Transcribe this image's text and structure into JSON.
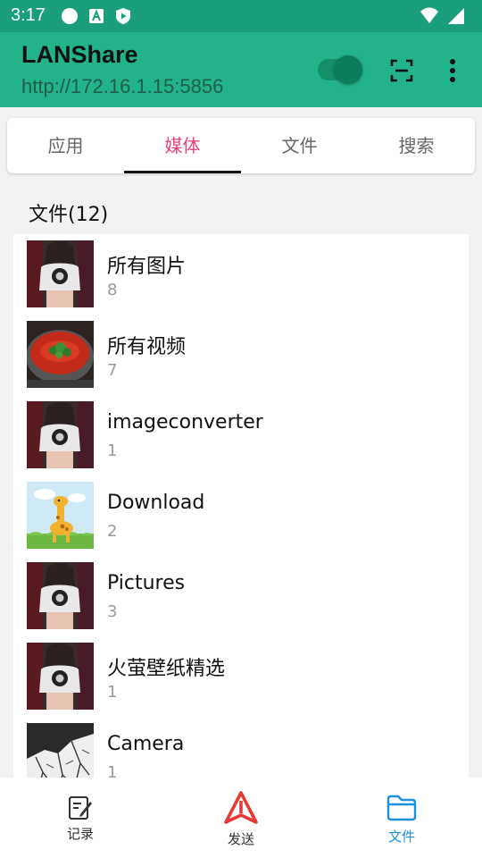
{
  "status_bar": {
    "time": "3:17",
    "left_icons": [
      "circle-icon",
      "font-a-icon",
      "shield-play-icon"
    ],
    "right_icons": [
      "wifi-icon",
      "cell-signal-icon"
    ]
  },
  "app_bar": {
    "title": "LANShare",
    "url": "http://172.16.1.15:5856",
    "toggle_on": true,
    "actions": [
      "scan-icon",
      "more-vert-icon"
    ],
    "colors": {
      "bar": "#22b38a",
      "status": "#1b9e7b"
    }
  },
  "tabs": [
    {
      "label": "应用",
      "active": false
    },
    {
      "label": "媒体",
      "active": true
    },
    {
      "label": "文件",
      "active": false
    },
    {
      "label": "搜索",
      "active": false
    }
  ],
  "section": {
    "title": "文件(12)"
  },
  "folders": [
    {
      "name": "所有图片",
      "count": "8",
      "thumb": "person-photo"
    },
    {
      "name": "所有视频",
      "count": "7",
      "thumb": "food-photo"
    },
    {
      "name": "imageconverter",
      "count": "1",
      "thumb": "person-photo"
    },
    {
      "name": "Download",
      "count": "2",
      "thumb": "giraffe-cartoon"
    },
    {
      "name": "Pictures",
      "count": "3",
      "thumb": "person-photo"
    },
    {
      "name": "火萤壁纸精选",
      "count": "1",
      "thumb": "person-photo"
    },
    {
      "name": "Camera",
      "count": "1",
      "thumb": "branches-photo"
    }
  ],
  "bottom_nav": [
    {
      "label": "记录",
      "icon": "edit-note-icon",
      "active": false
    },
    {
      "label": "发送",
      "icon": "send-triangle-icon",
      "active": false
    },
    {
      "label": "文件",
      "icon": "folder-icon",
      "active": true
    }
  ],
  "accent": {
    "tab_active": "#e8437a",
    "nav_active": "#1d8fe0",
    "send_icon": "#e53935"
  }
}
